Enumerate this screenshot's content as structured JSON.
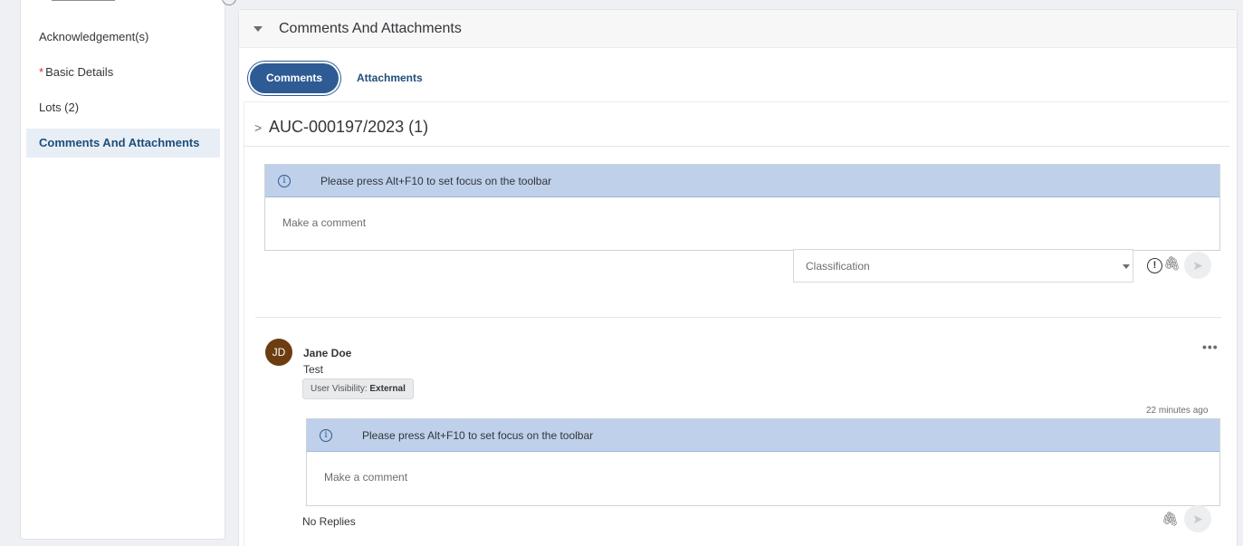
{
  "sidebar": {
    "items": [
      {
        "label": "Acknowledgement(s)",
        "required": false,
        "active": false
      },
      {
        "label": "Basic Details",
        "required": true,
        "active": false
      },
      {
        "label": "Lots (2)",
        "required": false,
        "active": false
      },
      {
        "label": "Comments And Attachments",
        "required": false,
        "active": true
      }
    ],
    "required_marker": "*"
  },
  "panel": {
    "title": "Comments And Attachments",
    "tabs": [
      {
        "label": "Comments",
        "active": true
      },
      {
        "label": "Attachments",
        "active": false
      }
    ],
    "section_title": "AUC-000197/2023 (1)",
    "section_chevron": ">"
  },
  "editor": {
    "toolbar_hint": "Please press Alt+F10 to set focus on the toolbar",
    "placeholder": "Make a comment",
    "info_glyph": "i"
  },
  "classification": {
    "placeholder": "Classification"
  },
  "icons": {
    "warning": "!",
    "clip": "🖇",
    "send": "➤",
    "more": "•••"
  },
  "comment": {
    "initials": "JD",
    "author": "Jane Doe",
    "text": "Test",
    "visibility_label": "User Visibility:",
    "visibility_value": "External",
    "timestamp": "22 minutes ago",
    "reply_hint": "Please press Alt+F10 to set focus on the toolbar",
    "reply_placeholder": "Make a comment",
    "replies_text": "No Replies"
  },
  "colors": {
    "accent": "#2e5b93",
    "toolbar_bg": "#bfd0ea",
    "avatar_bg": "#6b3d10",
    "sidebar_active_bg": "#e8eef6",
    "required": "#d93025"
  }
}
